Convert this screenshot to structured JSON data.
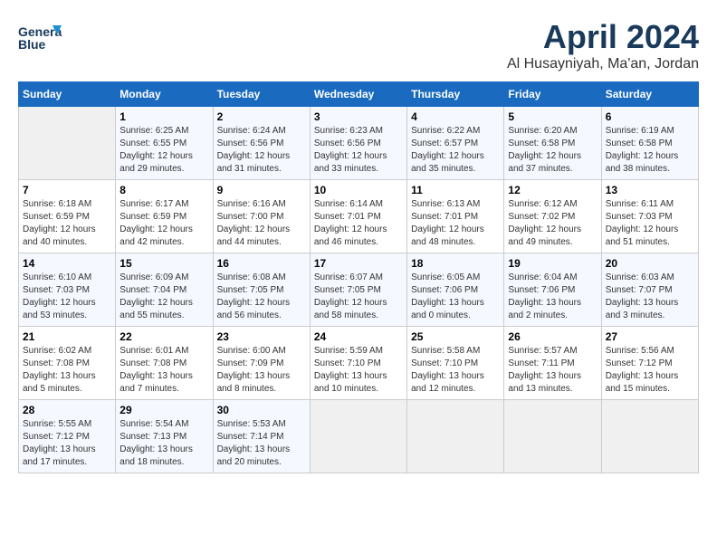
{
  "header": {
    "logo_text_top": "General",
    "logo_text_bottom": "Blue",
    "title": "April 2024",
    "subtitle": "Al Husayniyah, Ma'an, Jordan"
  },
  "calendar": {
    "days_of_week": [
      "Sunday",
      "Monday",
      "Tuesday",
      "Wednesday",
      "Thursday",
      "Friday",
      "Saturday"
    ],
    "weeks": [
      [
        {
          "num": "",
          "info": ""
        },
        {
          "num": "1",
          "info": "Sunrise: 6:25 AM\nSunset: 6:55 PM\nDaylight: 12 hours\nand 29 minutes."
        },
        {
          "num": "2",
          "info": "Sunrise: 6:24 AM\nSunset: 6:56 PM\nDaylight: 12 hours\nand 31 minutes."
        },
        {
          "num": "3",
          "info": "Sunrise: 6:23 AM\nSunset: 6:56 PM\nDaylight: 12 hours\nand 33 minutes."
        },
        {
          "num": "4",
          "info": "Sunrise: 6:22 AM\nSunset: 6:57 PM\nDaylight: 12 hours\nand 35 minutes."
        },
        {
          "num": "5",
          "info": "Sunrise: 6:20 AM\nSunset: 6:58 PM\nDaylight: 12 hours\nand 37 minutes."
        },
        {
          "num": "6",
          "info": "Sunrise: 6:19 AM\nSunset: 6:58 PM\nDaylight: 12 hours\nand 38 minutes."
        }
      ],
      [
        {
          "num": "7",
          "info": "Sunrise: 6:18 AM\nSunset: 6:59 PM\nDaylight: 12 hours\nand 40 minutes."
        },
        {
          "num": "8",
          "info": "Sunrise: 6:17 AM\nSunset: 6:59 PM\nDaylight: 12 hours\nand 42 minutes."
        },
        {
          "num": "9",
          "info": "Sunrise: 6:16 AM\nSunset: 7:00 PM\nDaylight: 12 hours\nand 44 minutes."
        },
        {
          "num": "10",
          "info": "Sunrise: 6:14 AM\nSunset: 7:01 PM\nDaylight: 12 hours\nand 46 minutes."
        },
        {
          "num": "11",
          "info": "Sunrise: 6:13 AM\nSunset: 7:01 PM\nDaylight: 12 hours\nand 48 minutes."
        },
        {
          "num": "12",
          "info": "Sunrise: 6:12 AM\nSunset: 7:02 PM\nDaylight: 12 hours\nand 49 minutes."
        },
        {
          "num": "13",
          "info": "Sunrise: 6:11 AM\nSunset: 7:03 PM\nDaylight: 12 hours\nand 51 minutes."
        }
      ],
      [
        {
          "num": "14",
          "info": "Sunrise: 6:10 AM\nSunset: 7:03 PM\nDaylight: 12 hours\nand 53 minutes."
        },
        {
          "num": "15",
          "info": "Sunrise: 6:09 AM\nSunset: 7:04 PM\nDaylight: 12 hours\nand 55 minutes."
        },
        {
          "num": "16",
          "info": "Sunrise: 6:08 AM\nSunset: 7:05 PM\nDaylight: 12 hours\nand 56 minutes."
        },
        {
          "num": "17",
          "info": "Sunrise: 6:07 AM\nSunset: 7:05 PM\nDaylight: 12 hours\nand 58 minutes."
        },
        {
          "num": "18",
          "info": "Sunrise: 6:05 AM\nSunset: 7:06 PM\nDaylight: 13 hours\nand 0 minutes."
        },
        {
          "num": "19",
          "info": "Sunrise: 6:04 AM\nSunset: 7:06 PM\nDaylight: 13 hours\nand 2 minutes."
        },
        {
          "num": "20",
          "info": "Sunrise: 6:03 AM\nSunset: 7:07 PM\nDaylight: 13 hours\nand 3 minutes."
        }
      ],
      [
        {
          "num": "21",
          "info": "Sunrise: 6:02 AM\nSunset: 7:08 PM\nDaylight: 13 hours\nand 5 minutes."
        },
        {
          "num": "22",
          "info": "Sunrise: 6:01 AM\nSunset: 7:08 PM\nDaylight: 13 hours\nand 7 minutes."
        },
        {
          "num": "23",
          "info": "Sunrise: 6:00 AM\nSunset: 7:09 PM\nDaylight: 13 hours\nand 8 minutes."
        },
        {
          "num": "24",
          "info": "Sunrise: 5:59 AM\nSunset: 7:10 PM\nDaylight: 13 hours\nand 10 minutes."
        },
        {
          "num": "25",
          "info": "Sunrise: 5:58 AM\nSunset: 7:10 PM\nDaylight: 13 hours\nand 12 minutes."
        },
        {
          "num": "26",
          "info": "Sunrise: 5:57 AM\nSunset: 7:11 PM\nDaylight: 13 hours\nand 13 minutes."
        },
        {
          "num": "27",
          "info": "Sunrise: 5:56 AM\nSunset: 7:12 PM\nDaylight: 13 hours\nand 15 minutes."
        }
      ],
      [
        {
          "num": "28",
          "info": "Sunrise: 5:55 AM\nSunset: 7:12 PM\nDaylight: 13 hours\nand 17 minutes."
        },
        {
          "num": "29",
          "info": "Sunrise: 5:54 AM\nSunset: 7:13 PM\nDaylight: 13 hours\nand 18 minutes."
        },
        {
          "num": "30",
          "info": "Sunrise: 5:53 AM\nSunset: 7:14 PM\nDaylight: 13 hours\nand 20 minutes."
        },
        {
          "num": "",
          "info": ""
        },
        {
          "num": "",
          "info": ""
        },
        {
          "num": "",
          "info": ""
        },
        {
          "num": "",
          "info": ""
        }
      ]
    ]
  }
}
